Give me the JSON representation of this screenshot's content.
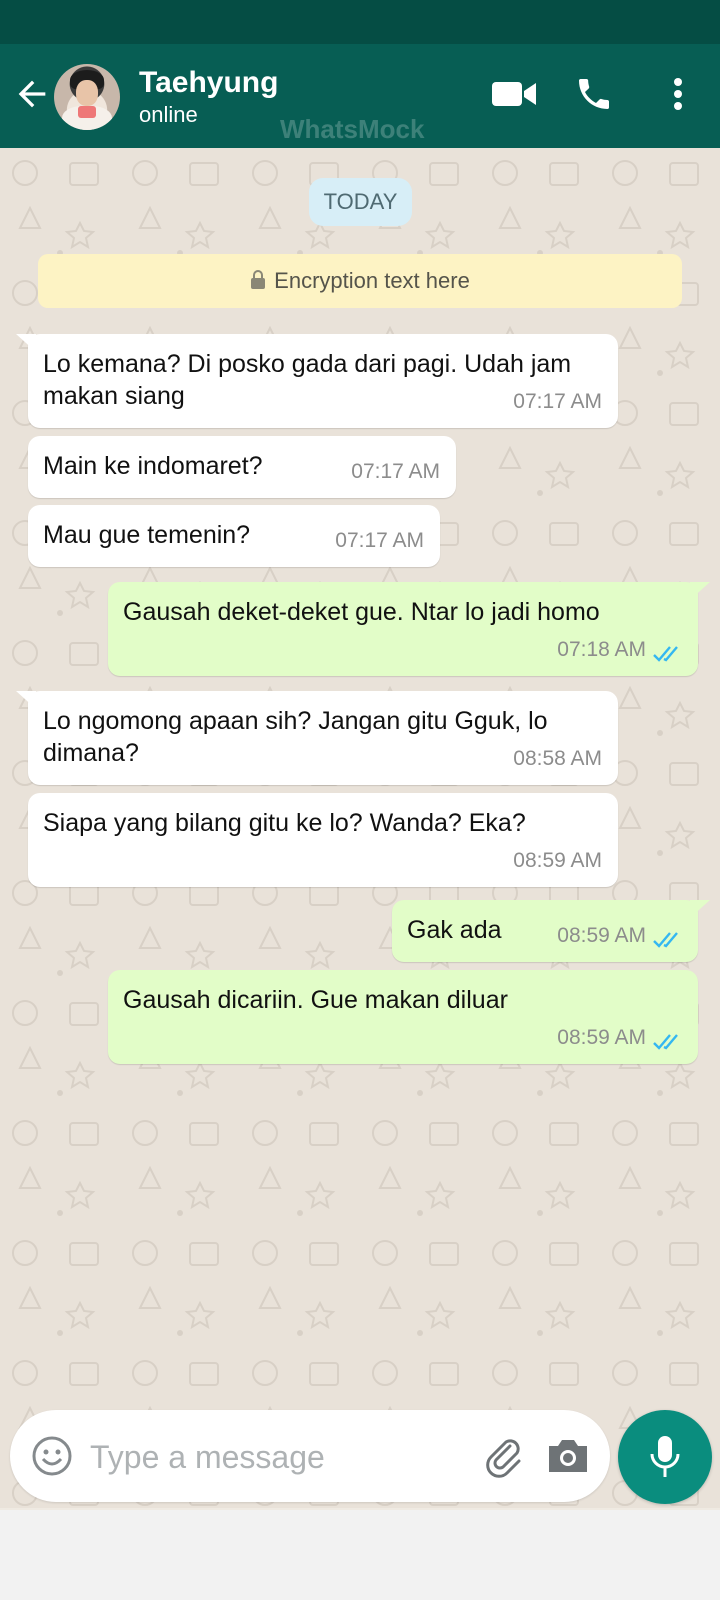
{
  "header": {
    "contact_name": "Taehyung",
    "contact_status": "online",
    "watermark": "WhatsMock"
  },
  "chat": {
    "date_label": "TODAY",
    "encryption_text": "Encryption text here",
    "messages": [
      {
        "direction": "in",
        "text": "Lo kemana? Di posko gada dari pagi. Udah jam makan siang",
        "time": "07:17 AM"
      },
      {
        "direction": "in",
        "text": "Main ke indomaret?",
        "time": "07:17 AM"
      },
      {
        "direction": "in",
        "text": "Mau gue temenin?",
        "time": "07:17 AM"
      },
      {
        "direction": "out",
        "text": "Gausah deket-deket gue. Ntar lo jadi homo",
        "time": "07:18 AM",
        "status": "read"
      },
      {
        "direction": "in",
        "text": "Lo ngomong apaan sih? Jangan gitu Gguk, lo dimana?",
        "time": "08:58 AM"
      },
      {
        "direction": "in",
        "text": "Siapa yang bilang gitu ke lo? Wanda? Eka?",
        "time": "08:59 AM"
      },
      {
        "direction": "out",
        "text": "Gak ada",
        "time": "08:59 AM",
        "status": "read"
      },
      {
        "direction": "out",
        "text": "Gausah dicariin. Gue makan diluar",
        "time": "08:59 AM",
        "status": "read"
      }
    ]
  },
  "composer": {
    "placeholder": "Type a message",
    "value": ""
  },
  "icons": {
    "back": "arrow-left-icon",
    "video": "video-camera-icon",
    "call": "phone-icon",
    "menu": "more-vert-icon",
    "emoji": "emoji-icon",
    "attach": "paperclip-icon",
    "camera": "camera-icon",
    "mic": "microphone-icon",
    "read_ticks": "double-check-icon",
    "lock": "lock-icon"
  },
  "colors": {
    "header": "#075e54",
    "status_bar": "#054d44",
    "outgoing_bubble": "#e2fdc8",
    "incoming_bubble": "#ffffff",
    "read_ticks": "#34b7f1",
    "mic_button": "#0a8d7e"
  }
}
